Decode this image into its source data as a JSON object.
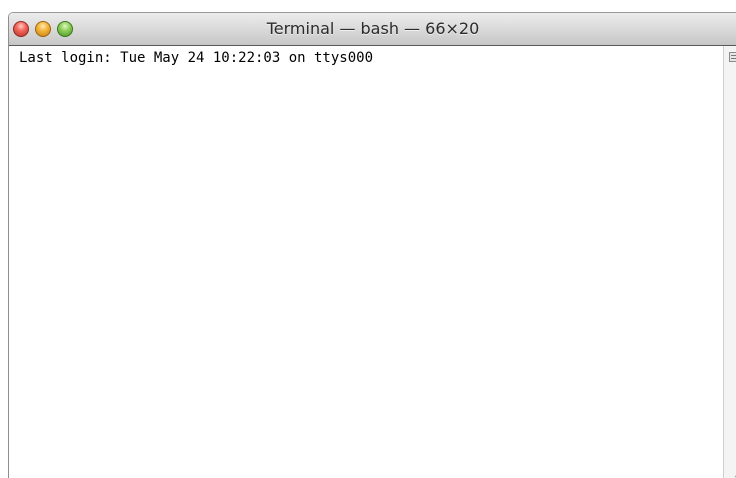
{
  "window": {
    "title": "Terminal — bash — 66×20"
  },
  "terminal": {
    "lines": [
      "Last login: Tue May 24 10:22:03 on ttys000"
    ]
  },
  "controls": {
    "close_icon": "close-icon",
    "minimize_icon": "minimize-icon",
    "zoom_icon": "zoom-icon",
    "split_icon": "split-pane-icon",
    "resize_icon": "resize-grip-icon"
  },
  "colors": {
    "close": "#f2655a",
    "minimize": "#f5b53c",
    "zoom": "#8ccf5a",
    "background": "#ffffff",
    "text": "#000000"
  }
}
